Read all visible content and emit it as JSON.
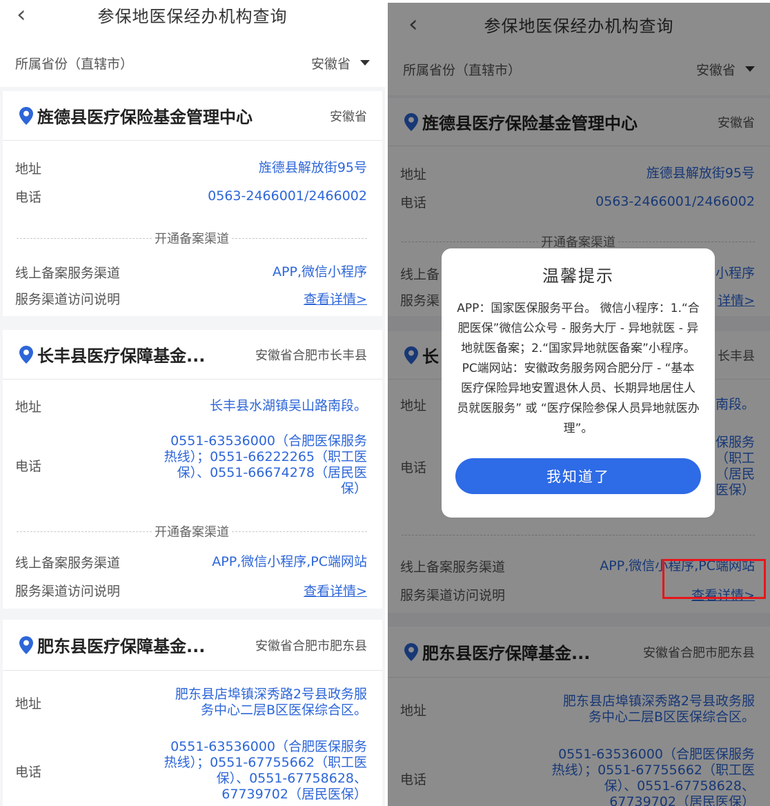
{
  "nav": {
    "back_glyph": "‹",
    "title": "参保地医保经办机构查询"
  },
  "province": {
    "label": "所属省份（直辖市）",
    "value": "安徽省"
  },
  "labels": {
    "address": "地址",
    "phone": "电话",
    "channel_divider": "开通备案渠道",
    "online_channel": "线上备案服务渠道",
    "channel_note": "服务渠道访问说明",
    "detail_link": "查看详情>"
  },
  "institutions": [
    {
      "name": "旌德县医疗保险基金管理中心",
      "region": "安徽省",
      "address": "旌德县解放街95号",
      "phone": "0563-2466001/2466002",
      "channels": "APP,微信小程序"
    },
    {
      "name": "长丰县医疗保障基金...",
      "region": "安徽省合肥市长丰县",
      "address": "长丰县水湖镇吴山路南段。",
      "phone": "0551-63536000（合肥医保服务热线）；0551-66222265（职工医保）、0551-66674278（居民医保）",
      "channels": "APP,微信小程序,PC端网站"
    },
    {
      "name": "肥东县医疗保障基金...",
      "region": "安徽省合肥市肥东县",
      "address": "肥东县店埠镇深秀路2号县政务服务中心二层B区医保综合区。",
      "phone": "0551-63536000（合肥医保服务热线）；0551-67755662（职工医保）、0551-67758628、67739702（居民医保）"
    }
  ],
  "right_partial": {
    "ch_prefix": "线上备",
    "note_prefix": "服务渠",
    "ch_suffix": "小程序",
    "link_suffix": "详情>",
    "name_prefix": "长",
    "region_suffix": "长丰县",
    "addr_suffix": "南段。",
    "phone_suffix": "保服务\n（职工\n（居民\n医保）"
  },
  "modal": {
    "title": "温馨提示",
    "body": "APP：国家医保服务平台。 微信小程序：1.“合肥医保”微信公众号 - 服务大厅 - 异地就医 - 异地就医备案；2.“国家异地就医备案”小程序。 PC端网站：安徽政务服务网合肥分厅 - “基本医疗保险异地安置退休人员、长期异地居住人员就医服务” 或 “医疗保险参保人员异地就医办理”。",
    "button": "我知道了"
  },
  "colors": {
    "accent": "#2d66d8",
    "highlight": "#e8161b"
  }
}
